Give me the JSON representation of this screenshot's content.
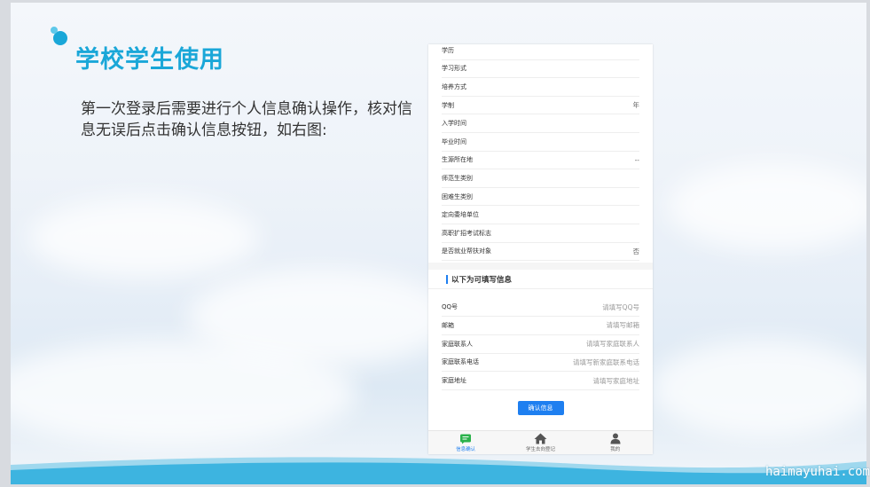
{
  "slide": {
    "title": "学校学生使用",
    "description": "第一次登录后需要进行个人信息确认操作，核对信息无误后点击确认信息按钮，如右图:"
  },
  "phone": {
    "info_rows": [
      {
        "label": "学历",
        "value": ""
      },
      {
        "label": "学习形式",
        "value": ""
      },
      {
        "label": "培养方式",
        "value": ""
      },
      {
        "label": "学制",
        "value": "年"
      },
      {
        "label": "入学时间",
        "value": ""
      },
      {
        "label": "毕业时间",
        "value": ""
      },
      {
        "label": "生源所在地",
        "value": "--"
      },
      {
        "label": "师范生类别",
        "value": ""
      },
      {
        "label": "困难生类别",
        "value": ""
      },
      {
        "label": "定向委培单位",
        "value": ""
      },
      {
        "label": "高职扩招考试标志",
        "value": ""
      },
      {
        "label": "是否就业帮扶对象",
        "value": "否"
      }
    ],
    "section_title": "以下为可填写信息",
    "editable_rows": [
      {
        "label": "QQ号",
        "placeholder": "请填写QQ号"
      },
      {
        "label": "邮箱",
        "placeholder": "请填写邮箱"
      },
      {
        "label": "家庭联系人",
        "placeholder": "请填写家庭联系人"
      },
      {
        "label": "家庭联系电话",
        "placeholder": "请填写新家庭联系电话"
      },
      {
        "label": "家庭地址",
        "placeholder": "请填写家庭地址"
      }
    ],
    "confirm_label": "确认信息",
    "tabs": [
      {
        "label": "信息确认",
        "icon": "chat-icon",
        "active": true
      },
      {
        "label": "学生去向登记",
        "icon": "home-icon",
        "active": false
      },
      {
        "label": "我的",
        "icon": "user-icon",
        "active": false
      }
    ]
  },
  "watermark": "haimayuhai.com",
  "colors": {
    "accent": "#1aa7d8",
    "button": "#1e7ff0",
    "wave": "#3db4e0"
  }
}
